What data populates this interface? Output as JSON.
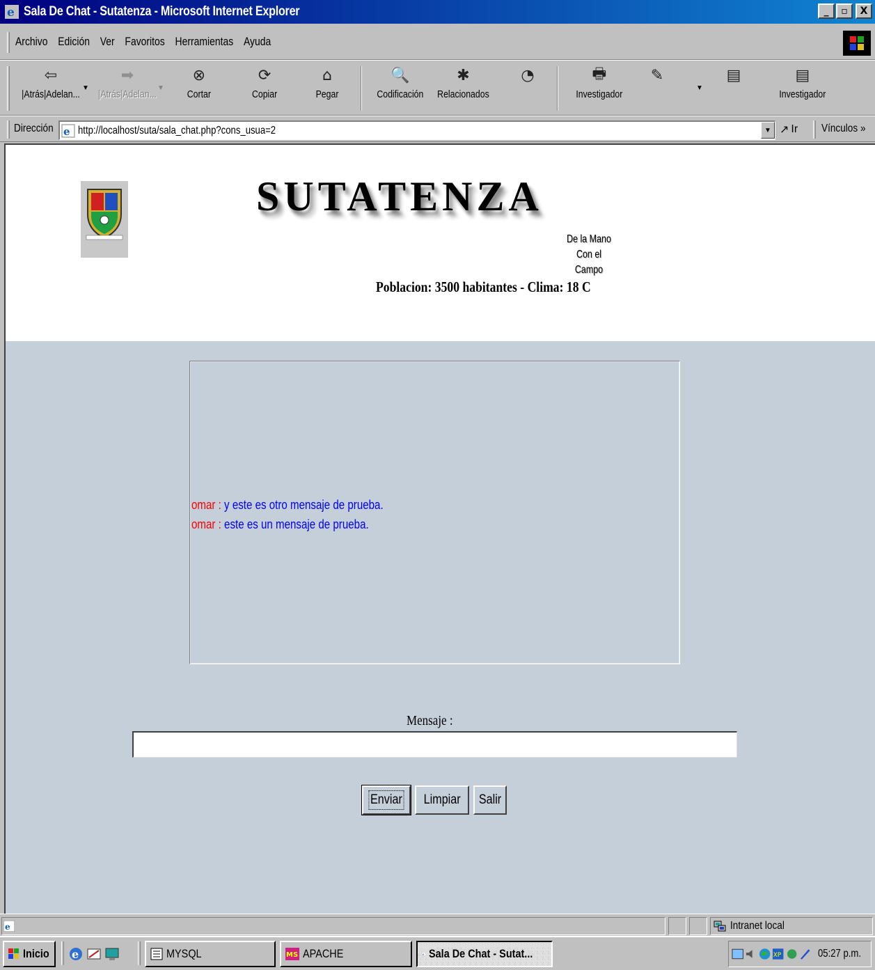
{
  "window": {
    "title": "Sala De Chat - Sutatenza - Microsoft Internet Explorer",
    "controls": [
      "_",
      "▫",
      "X"
    ]
  },
  "menu": [
    "Archivo",
    "Edición",
    "Ver",
    "Favoritos",
    "Herramientas",
    "Ayuda"
  ],
  "toolbar": {
    "buttons": [
      {
        "label": "|Atrás|Adelan...",
        "icon": "back-arrow-icon",
        "glyph": "⇦"
      },
      {
        "label": "|Atrás|Adelan...",
        "icon": "forward-arrow-icon",
        "glyph": "➡"
      },
      {
        "label": "Cortar",
        "icon": "stop-icon",
        "glyph": "⊗"
      },
      {
        "label": "Copiar",
        "icon": "refresh-icon",
        "glyph": "⟳"
      },
      {
        "label": "Pegar",
        "icon": "home-icon",
        "glyph": "⌂"
      },
      {
        "label": "Codificación",
        "icon": "search-icon",
        "glyph": "🔍"
      },
      {
        "label": "Relacionados",
        "icon": "favorites-icon",
        "glyph": "✱"
      },
      {
        "label": "Investigador",
        "icon": "print-icon",
        "glyph": "🖶"
      },
      {
        "label": "Investigador",
        "icon": "discuss-icon",
        "glyph": "▤"
      }
    ],
    "extra_icons": [
      "history-icon",
      "edit-icon",
      "page-icon"
    ]
  },
  "address": {
    "label": "Dirección",
    "url": "http://localhost/suta/sala_chat.php?cons_usua=2",
    "go": "Ir",
    "links": "Vínculos"
  },
  "page": {
    "brand": "SUTATENZA",
    "slogan_line1": "De la Mano",
    "slogan_line2": "Con el Campo",
    "stats": "Poblacion: 3500 habitantes - Clima: 18 C",
    "messages": [
      {
        "user": "omar : ",
        "text": "y este es otro mensaje de prueba."
      },
      {
        "user": "omar : ",
        "text": "este es un mensaje de prueba."
      }
    ],
    "message_label": "Mensaje :",
    "message_value": "",
    "buttons": {
      "send": "Enviar",
      "clear": "Limpiar",
      "exit": "Salir"
    },
    "colors": {
      "background": "#c5cfd9",
      "user": "#ff0000",
      "message": "#0000ff"
    }
  },
  "status": {
    "zone": "Intranet local"
  },
  "taskbar": {
    "start": "Inicio",
    "tasks": [
      "MYSQL",
      "APACHE",
      "Sala De Chat - Sutat..."
    ],
    "clock": "05:27 p.m."
  }
}
